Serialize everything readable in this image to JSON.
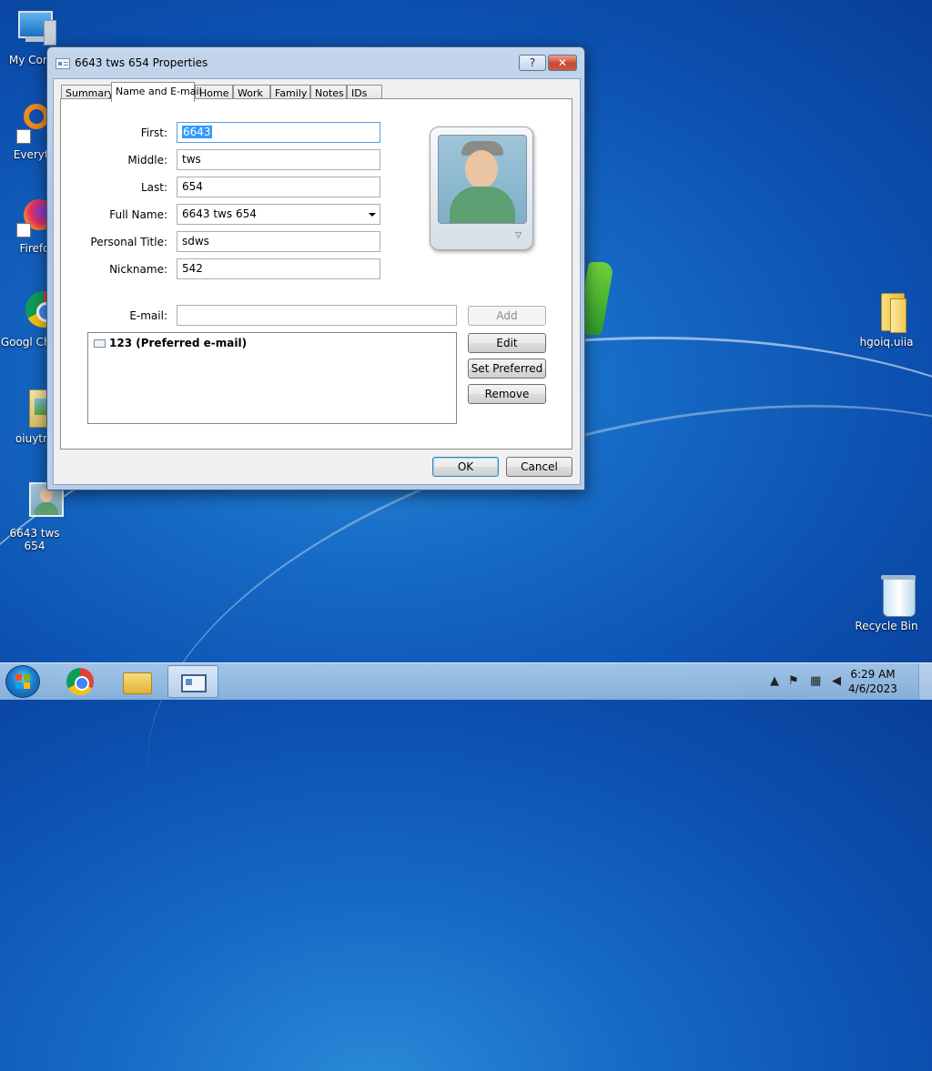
{
  "desktop": {
    "icons": [
      {
        "label": "My Comp"
      },
      {
        "label": "Everyth"
      },
      {
        "label": "Firefo"
      },
      {
        "label": "Googl Chron"
      },
      {
        "label": "oiuytre"
      },
      {
        "label": "6643 tws 654"
      },
      {
        "label": "hgoiq.uiia"
      },
      {
        "label": "Recycle Bin"
      }
    ]
  },
  "dialog": {
    "title": "6643 tws 654 Properties",
    "help_label": "?",
    "close_label": "✕",
    "tabs": [
      {
        "label": "Summary"
      },
      {
        "label": "Name and E-mail"
      },
      {
        "label": "Home"
      },
      {
        "label": "Work"
      },
      {
        "label": "Family"
      },
      {
        "label": "Notes"
      },
      {
        "label": "IDs"
      }
    ],
    "fields": {
      "first": {
        "label": "First:",
        "value": "6643"
      },
      "middle": {
        "label": "Middle:",
        "value": "tws"
      },
      "last": {
        "label": "Last:",
        "value": "654"
      },
      "full_name": {
        "label": "Full Name:",
        "value": "6643 tws 654"
      },
      "personal_title": {
        "label": "Personal Title:",
        "value": "sdws"
      },
      "nickname": {
        "label": "Nickname:",
        "value": "542"
      },
      "email": {
        "label": "E-mail:",
        "value": ""
      }
    },
    "email_list": [
      {
        "text": "123  (Preferred e-mail)"
      }
    ],
    "buttons": {
      "add": "Add",
      "edit": "Edit",
      "set_preferred": "Set Preferred",
      "remove": "Remove",
      "ok": "OK",
      "cancel": "Cancel"
    }
  },
  "taskbar": {
    "time": "6:29 AM",
    "date": "4/6/2023"
  }
}
